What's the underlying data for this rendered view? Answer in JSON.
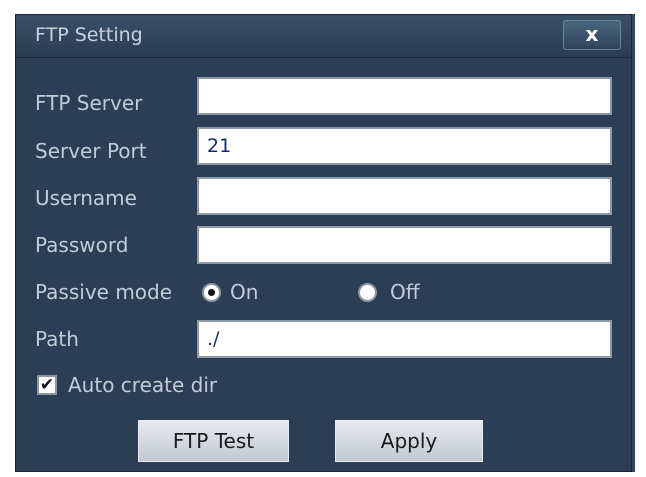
{
  "dialog": {
    "title": "FTP Setting",
    "close_label": "x"
  },
  "fields": {
    "server_label": "FTP Server",
    "server_value": "",
    "port_label": "Server Port",
    "port_value": "21",
    "username_label": "Username",
    "username_value": "",
    "password_label": "Password",
    "password_value": "",
    "path_label": "Path",
    "path_value": "./"
  },
  "passive_mode": {
    "label": "Passive mode",
    "on_label": "On",
    "off_label": "Off",
    "selected": "On"
  },
  "auto_create": {
    "label": "Auto create dir",
    "checked": true,
    "check_glyph": "✔"
  },
  "buttons": {
    "test_label": "FTP Test",
    "apply_label": "Apply"
  },
  "colors": {
    "dialog_bg": "#2c3e54",
    "label_text": "#c2ccd7",
    "field_text": "#1a2a6a"
  }
}
